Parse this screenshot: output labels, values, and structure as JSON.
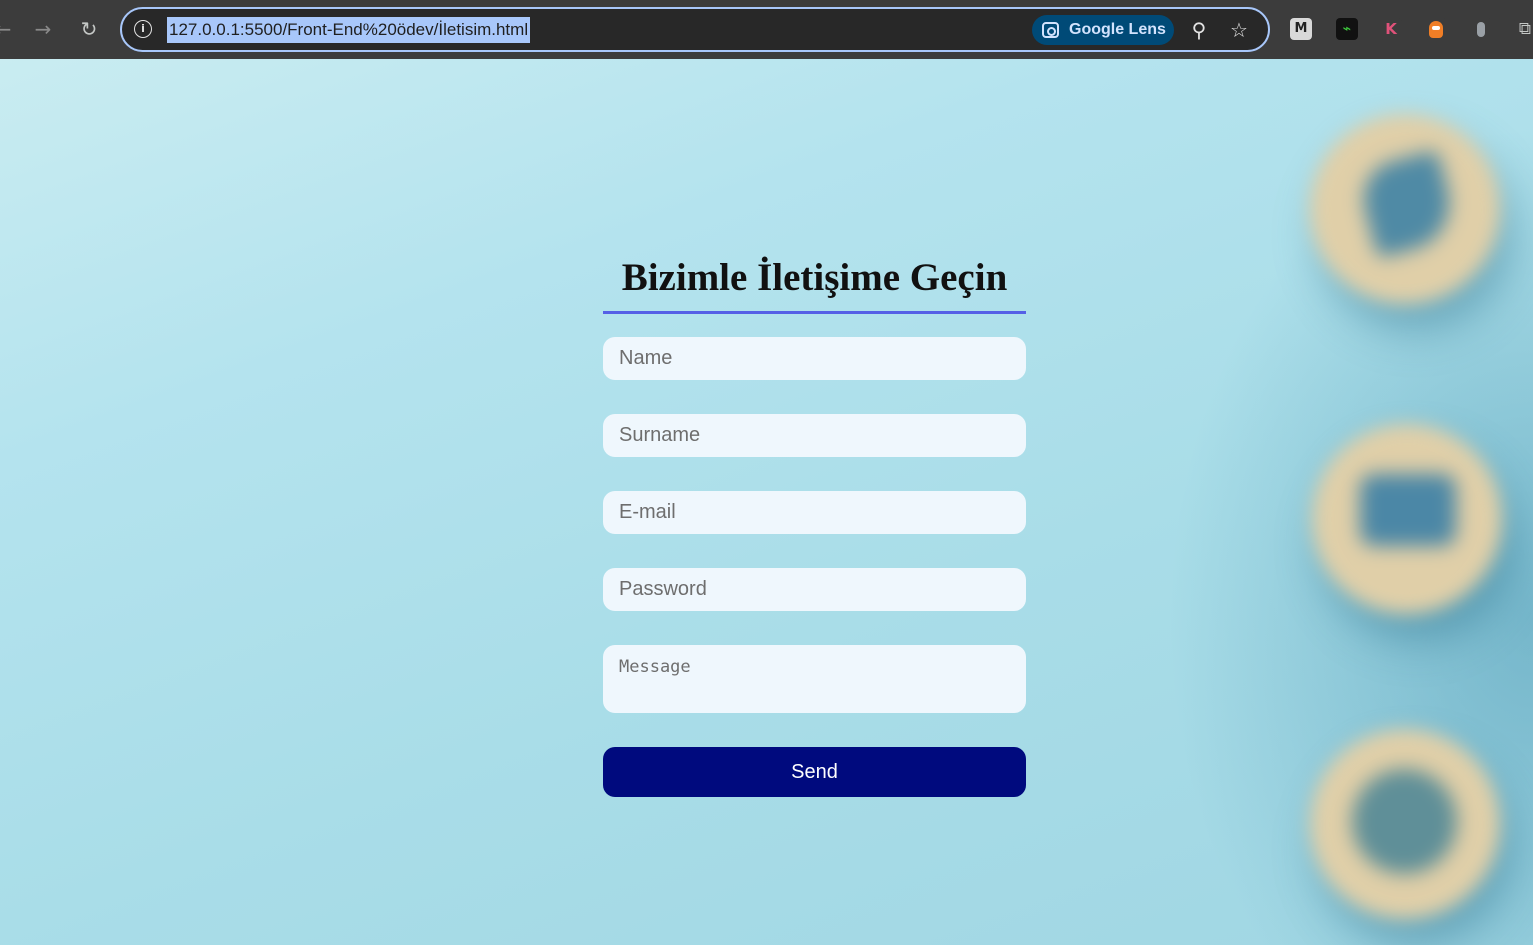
{
  "browser": {
    "nav": {
      "back": "→",
      "forward": "→",
      "reload": "↻"
    },
    "address_bar": {
      "url": "127.0.0.1:5500/Front-End%20ödev/İletisim.html"
    },
    "lens": {
      "label": "Google Lens",
      "icon": "lens-icon"
    },
    "toolbar_icons": [
      "zoom-icon",
      "bookmark-star-icon"
    ],
    "extensions": [
      {
        "name": "m-extension-icon",
        "glyph": "M"
      },
      {
        "name": "pulse-extension-icon",
        "glyph": "⌁"
      },
      {
        "name": "k-extension-icon",
        "glyph": "K"
      },
      {
        "name": "fox-extension-icon",
        "glyph": ""
      },
      {
        "name": "profile-dot-extension-icon",
        "glyph": ""
      },
      {
        "name": "extensions-puzzle-icon",
        "glyph": "⧉"
      }
    ]
  },
  "page": {
    "title": "Bizimle İletişime Geçin",
    "form": {
      "name_placeholder": "Name",
      "surname_placeholder": "Surname",
      "email_placeholder": "E-mail",
      "password_placeholder": "Password",
      "message_placeholder": "Message",
      "send_label": "Send"
    },
    "background_icons": [
      "phone-icon",
      "mail-icon",
      "location-icon"
    ],
    "colors": {
      "accent_underline": "#5560e6",
      "send_button": "#000a7e",
      "field_background": "#eff7fd"
    }
  }
}
